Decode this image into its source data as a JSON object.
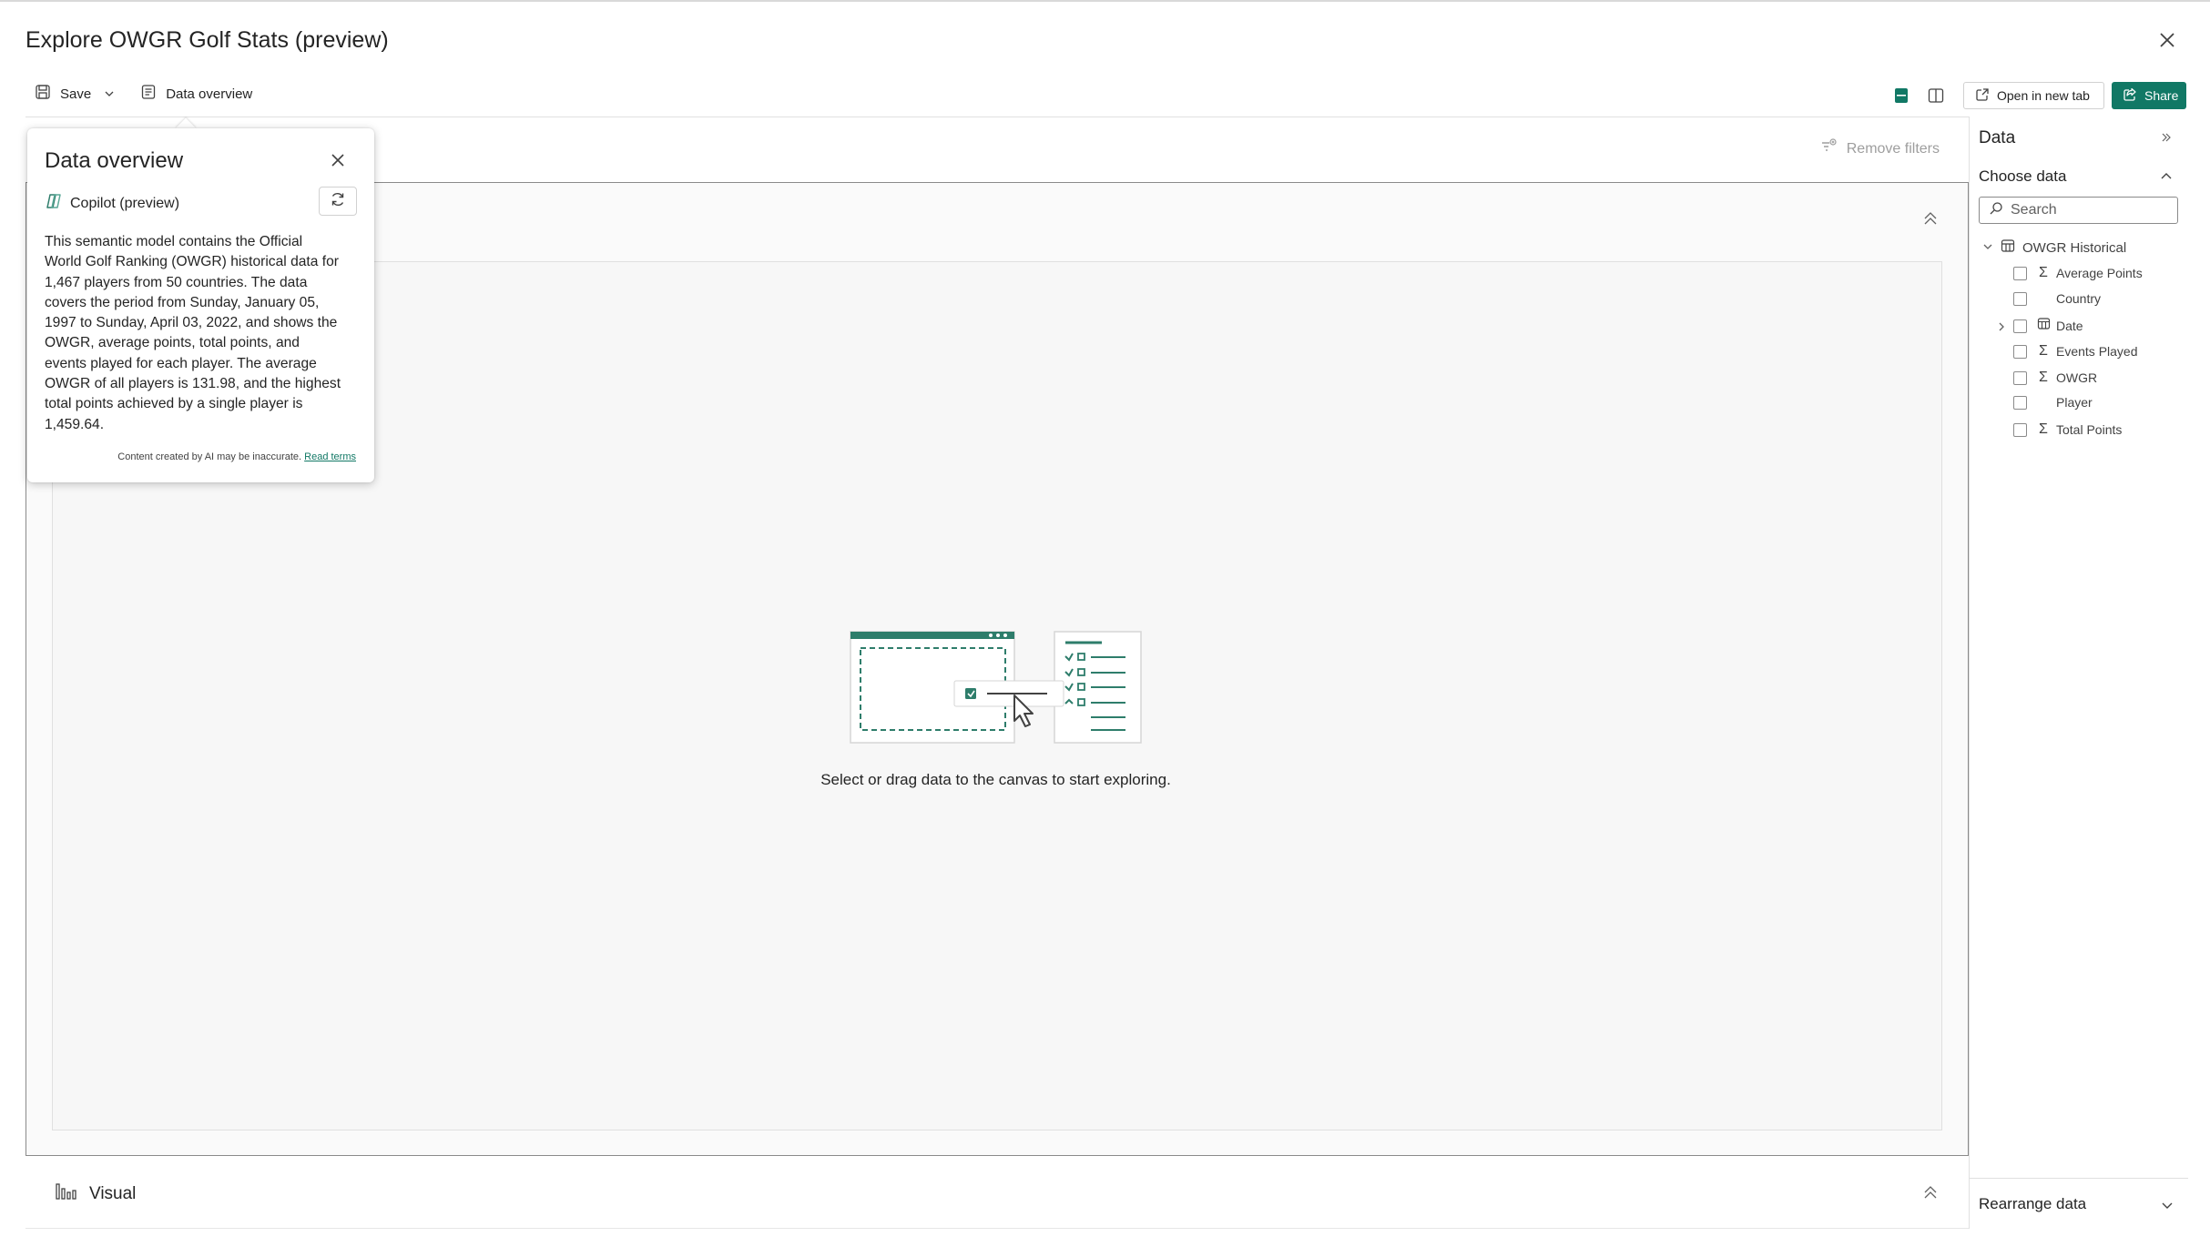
{
  "window": {
    "title": "Explore OWGR Golf Stats (preview)"
  },
  "toolbar": {
    "save_label": "Save",
    "data_overview_label": "Data overview",
    "open_new_tab_label": "Open in new tab",
    "share_label": "Share"
  },
  "canvas": {
    "remove_filters_label": "Remove filters",
    "empty_message": "Select or drag data to the canvas to start exploring.",
    "visual_label": "Visual"
  },
  "data_pane": {
    "title": "Data",
    "choose_data_label": "Choose data",
    "search_placeholder": "Search",
    "table_name": "OWGR Historical",
    "fields": [
      {
        "label": "Average Points",
        "icon": "sigma-icon",
        "checked": false
      },
      {
        "label": "Country",
        "icon": "none",
        "checked": false
      },
      {
        "label": "Date",
        "icon": "calendar-table-icon",
        "checked": false,
        "expandable": true
      },
      {
        "label": "Events Played",
        "icon": "sigma-icon",
        "checked": false
      },
      {
        "label": "OWGR",
        "icon": "sigma-icon",
        "checked": false
      },
      {
        "label": "Player",
        "icon": "none",
        "checked": false
      },
      {
        "label": "Total Points",
        "icon": "sigma-icon",
        "checked": false
      }
    ],
    "rearrange_label": "Rearrange data"
  },
  "popover": {
    "title": "Data overview",
    "copilot_label": "Copilot (preview)",
    "body_lines": [
      "This semantic model contains the Official",
      "World Golf Ranking (OWGR) historical data for",
      "1,467 players from 50 countries. The data",
      "covers the period from Sunday, January 05,",
      "1997 to Sunday, April 03, 2022, and shows the",
      "OWGR, average points, total points, and",
      "events played for each player. The average",
      "OWGR of all players is 131.98, and the highest",
      "total points achieved by a single player is",
      "1,459.64."
    ],
    "disclaimer": "Content created by AI may be inaccurate.",
    "read_terms_label": "Read terms"
  },
  "colors": {
    "accent": "#117865",
    "border": "#8a8a8a",
    "canvas_bg": "#f7f7f7"
  }
}
